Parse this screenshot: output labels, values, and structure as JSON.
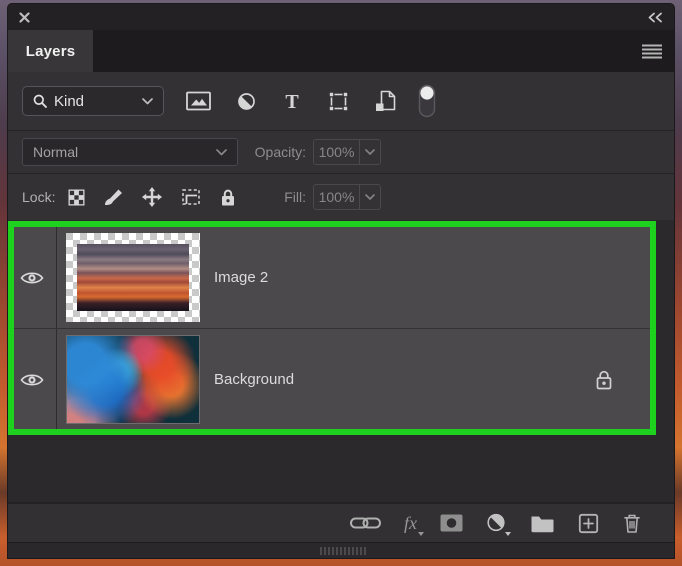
{
  "window": {
    "close_glyph": "✕",
    "collapse_glyph": "«"
  },
  "panel": {
    "tab_label": "Layers"
  },
  "filter_bar": {
    "kind_label": "Kind",
    "filter_type_icons": [
      "image-filter-icon",
      "adjustment-filter-icon",
      "type-filter-icon",
      "shape-filter-icon",
      "smart-object-filter-icon"
    ],
    "filter_toggle": "off"
  },
  "blend_bar": {
    "blend_mode": "Normal",
    "opacity_label": "Opacity:",
    "opacity_value": "100%"
  },
  "lock_bar": {
    "lock_label": "Lock:",
    "lock_icons": [
      "lock-transparency-icon",
      "lock-pixels-icon",
      "lock-position-icon",
      "lock-artboard-icon",
      "lock-all-icon"
    ],
    "fill_label": "Fill:",
    "fill_value": "100%"
  },
  "layers": [
    {
      "name": "Image 2",
      "visible": true,
      "locked": false
    },
    {
      "name": "Background",
      "visible": true,
      "locked": true
    }
  ],
  "toolbar_icons": [
    "link-icon",
    "effects-icon",
    "mask-icon",
    "adjustment-icon",
    "group-icon",
    "new-layer-icon",
    "delete-icon"
  ],
  "colors": {
    "selection_outline_green": "#1fd11f",
    "panel_bg": "#333133",
    "selected_row_bg": "#4b494b",
    "titlebar_bg": "#232123"
  }
}
